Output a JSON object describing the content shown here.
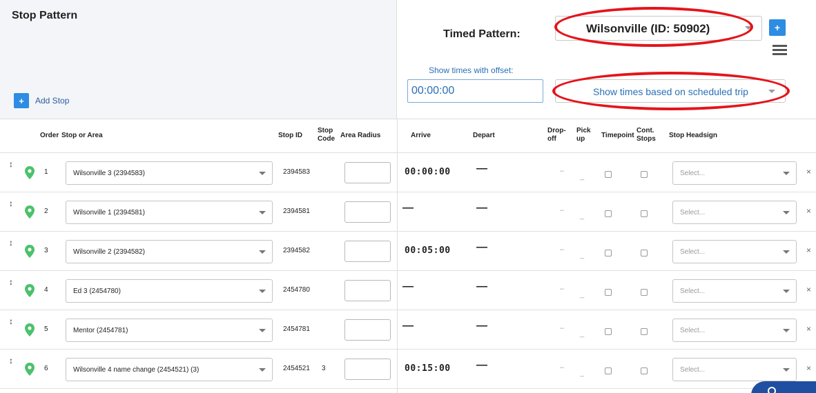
{
  "stop_pattern": {
    "title": "Stop Pattern",
    "add_stop_label": "Add Stop"
  },
  "timed_pattern": {
    "label": "Timed Pattern:",
    "selected": "Wilsonville (ID: 50902)",
    "offset_label": "Show times with offset:",
    "offset_value": "00:00:00",
    "show_times_selected": "Show times based on scheduled trip"
  },
  "table": {
    "headers": {
      "order": "Order",
      "stop_or_area": "Stop or Area",
      "stop_id": "Stop ID",
      "stop_code": "Stop Code",
      "area_radius": "Area Radius",
      "arrive": "Arrive",
      "depart": "Depart",
      "drop_off": "Drop-off",
      "pick_up": "Pick up",
      "timepoint": "Timepoint",
      "cont_stops": "Cont. Stops",
      "stop_headsign": "Stop Headsign"
    },
    "rows": [
      {
        "order": "1",
        "stop": "Wilsonville 3 (2394583)",
        "stop_id": "2394583",
        "stop_code": "",
        "arrive": "00:00:00",
        "depart": "—",
        "drop": "–",
        "pick": "_",
        "headsign": "Select...",
        "remove": "×"
      },
      {
        "order": "2",
        "stop": "Wilsonville 1 (2394581)",
        "stop_id": "2394581",
        "stop_code": "",
        "arrive": "—",
        "depart": "—",
        "drop": "–",
        "pick": "_",
        "headsign": "Select...",
        "remove": "×"
      },
      {
        "order": "3",
        "stop": "Wilsonville 2 (2394582)",
        "stop_id": "2394582",
        "stop_code": "",
        "arrive": "00:05:00",
        "depart": "—",
        "drop": "–",
        "pick": "_",
        "headsign": "Select...",
        "remove": "×"
      },
      {
        "order": "4",
        "stop": "Ed 3 (2454780)",
        "stop_id": "2454780",
        "stop_code": "",
        "arrive": "—",
        "depart": "—",
        "drop": "–",
        "pick": "_",
        "headsign": "Select...",
        "remove": "×"
      },
      {
        "order": "5",
        "stop": "Mentor (2454781)",
        "stop_id": "2454781",
        "stop_code": "",
        "arrive": "—",
        "depart": "—",
        "drop": "–",
        "pick": "_",
        "headsign": "Select...",
        "remove": "×"
      },
      {
        "order": "6",
        "stop": "Wilsonville 4 name change (2454521) (3)",
        "stop_id": "2454521",
        "stop_code": "3",
        "arrive": "00:15:00",
        "depart": "—",
        "drop": "–",
        "pick": "_",
        "headsign": "Select...",
        "remove": "×"
      }
    ]
  },
  "icons": {
    "add": "plus-icon",
    "menu": "hamburger-icon",
    "drag": "drag-handle-icon",
    "pin": "map-pin-icon",
    "remove": "close-icon",
    "help": "help-chat-icon"
  },
  "colors": {
    "accent": "#2d8ce3",
    "pin": "#4cc16b",
    "annotation": "#e4141a",
    "link_text": "#2a6fb5"
  },
  "glyphs": {
    "plus": "+",
    "drag": "↕"
  }
}
